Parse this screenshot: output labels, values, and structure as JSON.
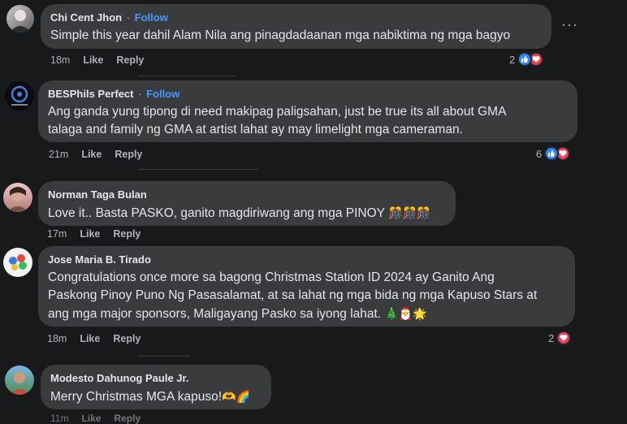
{
  "comments": [
    {
      "name": "Chi Cent Jhon",
      "follow": "Follow",
      "text": "Simple this year dahil Alam Nila ang pinagdadaanan mga nabiktima ng mga bagyo",
      "time": "18m",
      "like": "Like",
      "reply": "Reply",
      "reaction_count": "2",
      "more": "···"
    },
    {
      "name": "BESPhils Perfect",
      "follow": "Follow",
      "text_line1": "Ang ganda yung tipong di need makipag paligsahan, just be true its all about GMA",
      "text_line2": "talaga and family ng GMA at artist lahat ay may limelight mga cameraman.",
      "time": "21m",
      "like": "Like",
      "reply": "Reply",
      "reaction_count": "6"
    },
    {
      "name": "Norman Taga Bulan",
      "text": "Love it.. Basta PASKO, ganito magdiriwang ang mga PINOY",
      "time": "17m",
      "like": "Like",
      "reply": "Reply"
    },
    {
      "name": "Jose Maria B. Tirado",
      "text_line1": "Congratulations once more sa bagong Christmas Station ID 2024 ay Ganito Ang",
      "text_line2": "Paskong Pinoy Puno Ng Pasasalamat, at sa lahat ng mga bida ng mga Kapuso Stars at",
      "text_line3": "ang mga major sponsors, Maligayang Pasko sa iyong lahat.",
      "time": "18m",
      "like": "Like",
      "reply": "Reply",
      "reaction_count": "2"
    },
    {
      "name": "Modesto Dahunog Paule Jr.",
      "text": "Merry Christmas MGA kapuso!",
      "time": "11m",
      "like": "Like",
      "reply": "Reply"
    }
  ],
  "colors": {
    "background": "#18191a",
    "bubble": "#3a3b3c",
    "follow": "#4599ff",
    "like": "#2d88ff",
    "love": "#f33e58"
  }
}
